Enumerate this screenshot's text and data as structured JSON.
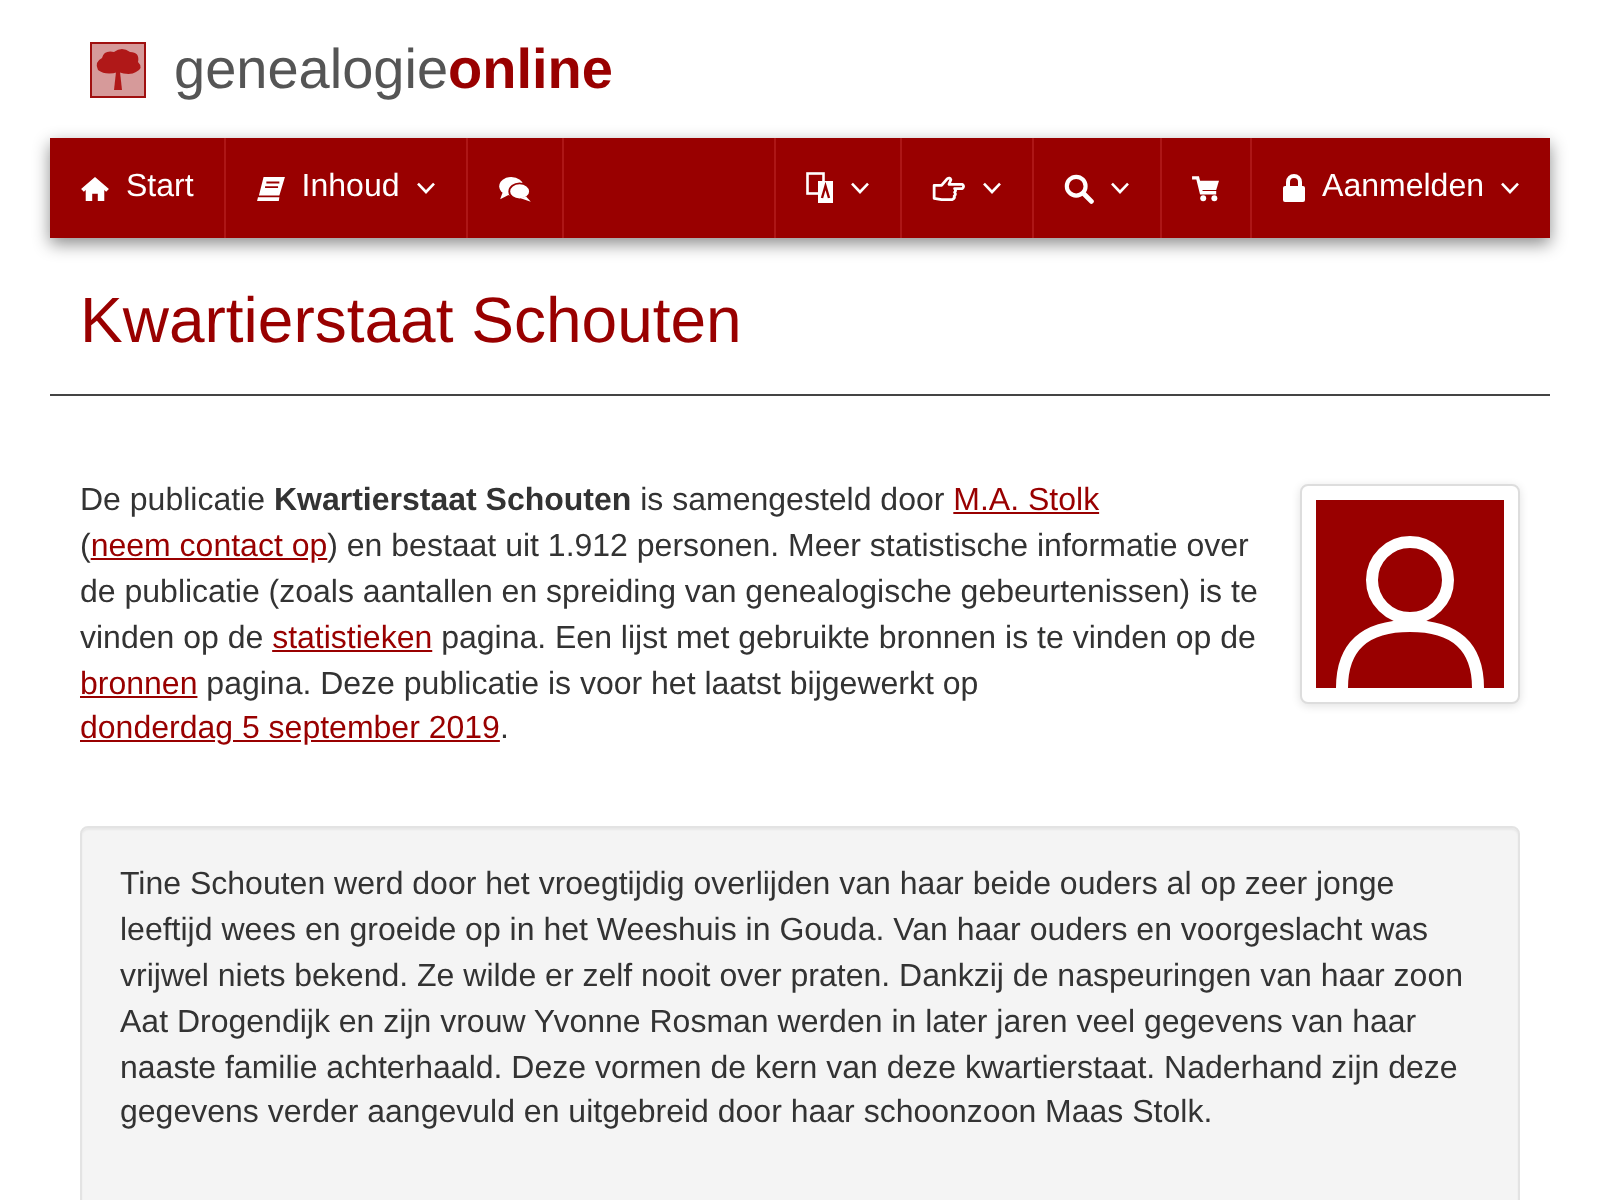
{
  "logo": {
    "text": "genealogie**online**"
  },
  "navbar": {
    "left": [
      {
        "label": "Start",
        "dropdown": false
      },
      {
        "label": "Inhoud",
        "dropdown": true
      },
      {
        "dropdown": false
      }
    ],
    "right": [
      {
        "dropdown": true
      },
      {
        "dropdown": true
      },
      {
        "dropdown": true
      },
      {
        "dropdown": false
      },
      {
        "label": "Aanmelden",
        "dropdown": true
      }
    ]
  },
  "page_title": "Kwartierstaat Schouten",
  "intro": [
    {
      "kind": "text",
      "text": "De publicatie **Kwartierstaat Schouten** is samengesteld door "
    },
    {
      "kind": "link",
      "text": "M.A. Stolk"
    },
    {
      "kind": "text",
      "text": " ("
    },
    {
      "kind": "link",
      "text": "neem contact op"
    },
    {
      "kind": "text",
      "text": ") en bestaat uit 1.912 personen. Meer statistische informatie over de publicatie (zoals aantallen en spreiding van genealogische gebeurtenissen) is te vinden op de "
    },
    {
      "kind": "link",
      "text": "statistieken"
    },
    {
      "kind": "text",
      "text": " pagina. Een lijst met gebruikte bronnen is te vinden op de "
    },
    {
      "kind": "link",
      "text": "bronnen"
    },
    {
      "kind": "text",
      "text": " pagina. Deze publicatie is voor het laatst bijgewerkt op "
    },
    {
      "kind": "link",
      "text": "donderdag 5 september 2019"
    },
    {
      "kind": "text",
      "text": "."
    }
  ],
  "description": "Tine Schouten werd door het vroegtijdig overlijden van haar beide ouders al op zeer jonge leeftijd wees en groeide op in het Weeshuis in Gouda. Van haar ouders en voorgeslacht was vrijwel niets bekend. Ze wilde er zelf nooit over praten. Dankzij de naspeuringen van haar zoon Aat Drogendijk en zijn vrouw Yvonne Rosman werden in later jaren veel gegevens van haar naaste familie achterhaald. Deze vormen de kern van deze kwartierstaat. Naderhand zijn deze gegevens verder aangevuld en uitgebreid door haar schoonzoon Maas Stolk."
}
